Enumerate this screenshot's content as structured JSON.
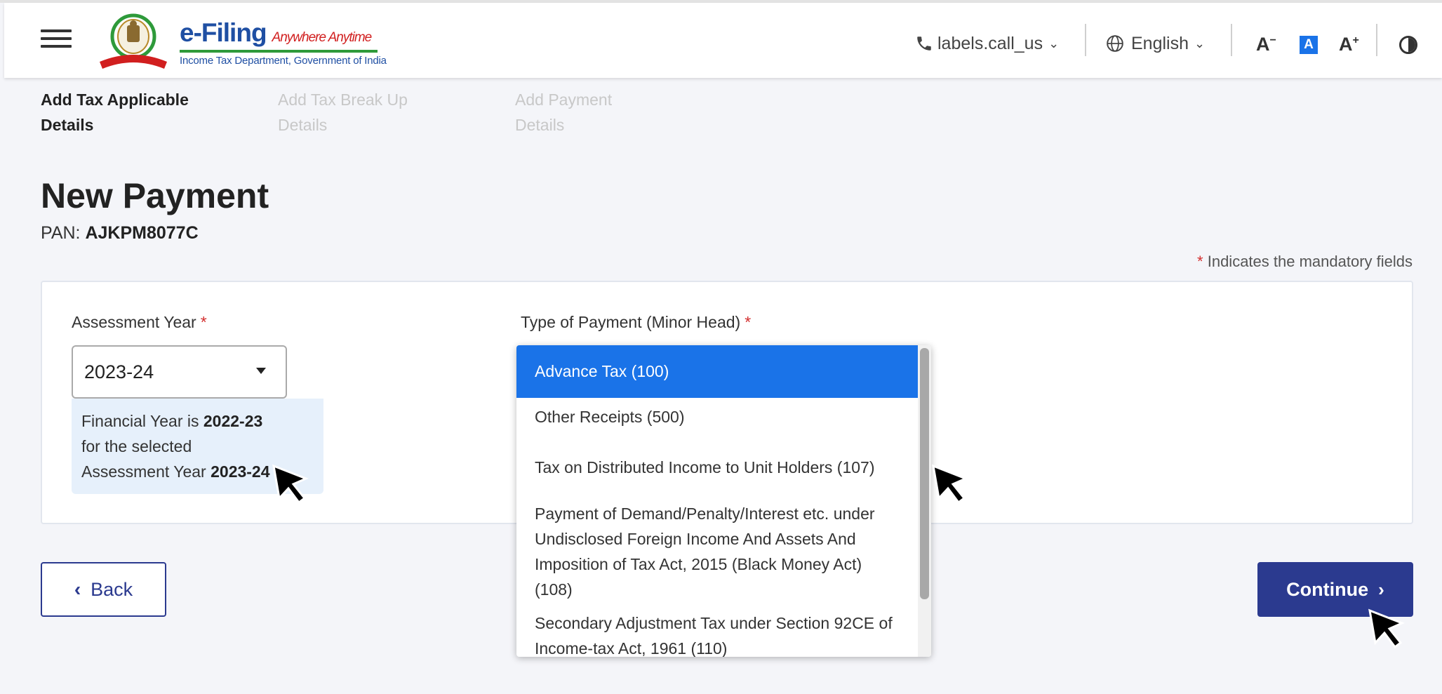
{
  "header": {
    "logo_title": "e-Filing",
    "logo_tagline": "Anywhere Anytime",
    "logo_subtitle": "Income Tax Department, Government of India",
    "call_label": "labels.call_us",
    "language": "English",
    "font_decrease": "A",
    "font_normal": "A",
    "font_increase": "A",
    "icons": [
      "menu-icon",
      "emblem-logo",
      "phone-icon",
      "globe-icon",
      "chevron-down-icon",
      "contrast-icon"
    ]
  },
  "stepper": {
    "steps": [
      {
        "line1": "Add Tax Applicable",
        "line2": "Details"
      },
      {
        "line1": "Add Tax Break Up",
        "line2": "Details"
      },
      {
        "line1": "Add Payment",
        "line2": "Details"
      }
    ]
  },
  "page": {
    "title": "New Payment",
    "pan_label": "PAN:",
    "pan_value": "AJKPM8077C",
    "mandatory_note": "Indicates the mandatory fields",
    "mandatory_asterisk": "*"
  },
  "form": {
    "assessment_year_label": "Assessment Year",
    "assessment_year_value": "2023-24",
    "fy_info": {
      "part1": "Financial Year is ",
      "fy": "2022-23",
      "part2": "for the selected",
      "part3": "Assessment Year ",
      "ay": "2023-24"
    },
    "payment_type_label": "Type of Payment (Minor Head)",
    "required_mark": "*",
    "payment_options": [
      "Advance Tax (100)",
      "Other Receipts (500)",
      "Tax on Distributed Income to Unit Holders (107)",
      "Payment of Demand/Penalty/Interest etc. under Undisclosed Foreign Income And Assets And Imposition of Tax Act, 2015 (Black Money Act) (108)",
      "Secondary Adjustment Tax under Section 92CE of Income-tax Act, 1961 (110)"
    ],
    "selected_option_index": 0
  },
  "buttons": {
    "back": "Back",
    "continue": "Continue"
  },
  "colors": {
    "primary": "#2b3a8f",
    "highlight": "#1a73e8",
    "required": "#d32f2f",
    "info_bg": "#e6f0fb"
  }
}
